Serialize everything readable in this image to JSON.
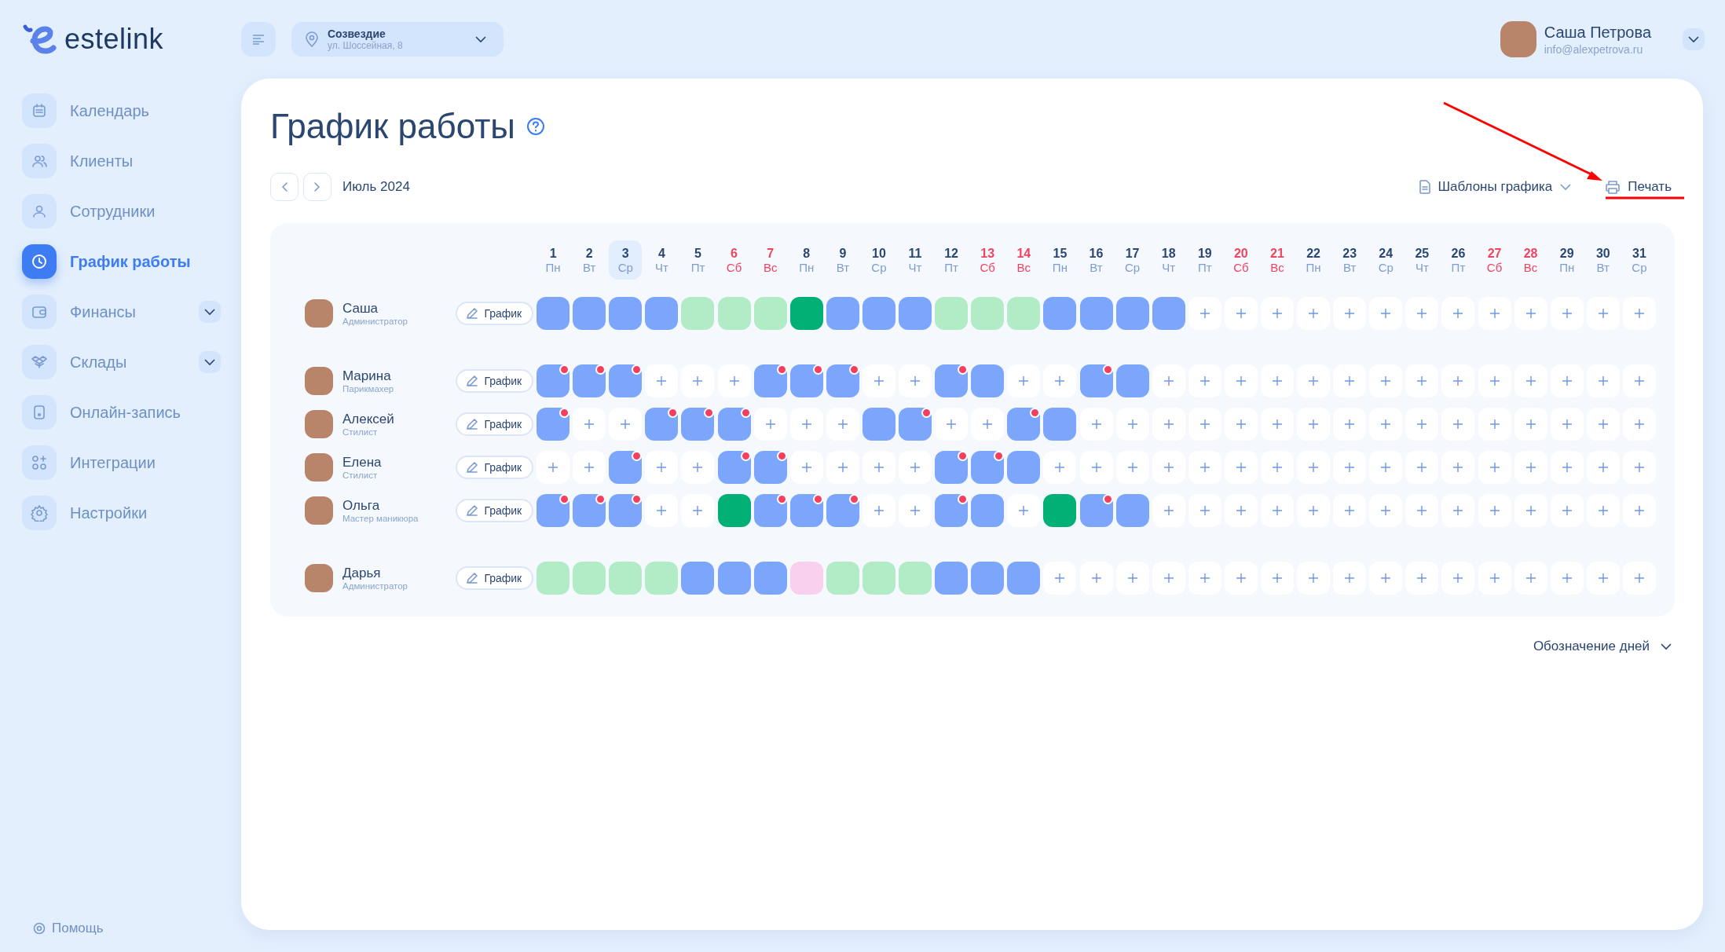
{
  "logo": {
    "text": "estelink"
  },
  "location": {
    "name": "Созвездие",
    "address": "ул. Шоссейная, 8"
  },
  "user": {
    "name": "Саша Петрова",
    "email": "info@alexpetrova.ru"
  },
  "sidebar": {
    "items": [
      {
        "label": "Календарь",
        "selected": false,
        "expandable": false
      },
      {
        "label": "Клиенты",
        "selected": false,
        "expandable": false
      },
      {
        "label": "Сотрудники",
        "selected": false,
        "expandable": false
      },
      {
        "label": "График работы",
        "selected": true,
        "expandable": false
      },
      {
        "label": "Финансы",
        "selected": false,
        "expandable": true
      },
      {
        "label": "Склады",
        "selected": false,
        "expandable": true
      },
      {
        "label": "Онлайн-запись",
        "selected": false,
        "expandable": false
      },
      {
        "label": "Интеграции",
        "selected": false,
        "expandable": false
      },
      {
        "label": "Настройки",
        "selected": false,
        "expandable": false
      }
    ],
    "help": "Помощь"
  },
  "page": {
    "title": "График работы",
    "month": "Июль 2024",
    "templates": "Шаблоны графика",
    "print": {
      "label": "Печать",
      "highlighted": true
    },
    "legend": "Обозначение дней"
  },
  "day_columns": [
    {
      "day": "1",
      "weekday": "Пн",
      "weekend": false,
      "selected": false
    },
    {
      "day": "2",
      "weekday": "Вт",
      "weekend": false,
      "selected": false
    },
    {
      "day": "3",
      "weekday": "Ср",
      "weekend": false,
      "selected": true
    },
    {
      "day": "4",
      "weekday": "Чт",
      "weekend": false,
      "selected": false
    },
    {
      "day": "5",
      "weekday": "Пт",
      "weekend": false,
      "selected": false
    },
    {
      "day": "6",
      "weekday": "Сб",
      "weekend": true,
      "selected": false
    },
    {
      "day": "7",
      "weekday": "Вс",
      "weekend": true,
      "selected": false
    },
    {
      "day": "8",
      "weekday": "Пн",
      "weekend": false,
      "selected": false
    },
    {
      "day": "9",
      "weekday": "Вт",
      "weekend": false,
      "selected": false
    },
    {
      "day": "10",
      "weekday": "Ср",
      "weekend": false,
      "selected": false
    },
    {
      "day": "11",
      "weekday": "Чт",
      "weekend": false,
      "selected": false
    },
    {
      "day": "12",
      "weekday": "Пт",
      "weekend": false,
      "selected": false
    },
    {
      "day": "13",
      "weekday": "Сб",
      "weekend": true,
      "selected": false
    },
    {
      "day": "14",
      "weekday": "Вс",
      "weekend": true,
      "selected": false
    },
    {
      "day": "15",
      "weekday": "Пн",
      "weekend": false,
      "selected": false
    },
    {
      "day": "16",
      "weekday": "Вт",
      "weekend": false,
      "selected": false
    },
    {
      "day": "17",
      "weekday": "Ср",
      "weekend": false,
      "selected": false
    },
    {
      "day": "18",
      "weekday": "Чт",
      "weekend": false,
      "selected": false
    },
    {
      "day": "19",
      "weekday": "Пт",
      "weekend": false,
      "selected": false
    },
    {
      "day": "20",
      "weekday": "Сб",
      "weekend": true,
      "selected": false
    },
    {
      "day": "21",
      "weekday": "Вс",
      "weekend": true,
      "selected": false
    },
    {
      "day": "22",
      "weekday": "Пн",
      "weekend": false,
      "selected": false
    },
    {
      "day": "23",
      "weekday": "Вт",
      "weekend": false,
      "selected": false
    },
    {
      "day": "24",
      "weekday": "Ср",
      "weekend": false,
      "selected": false
    },
    {
      "day": "25",
      "weekday": "Чт",
      "weekend": false,
      "selected": false
    },
    {
      "day": "26",
      "weekday": "Пт",
      "weekend": false,
      "selected": false
    },
    {
      "day": "27",
      "weekday": "Сб",
      "weekend": true,
      "selected": false
    },
    {
      "day": "28",
      "weekday": "Вс",
      "weekend": true,
      "selected": false
    },
    {
      "day": "29",
      "weekday": "Пн",
      "weekend": false,
      "selected": false
    },
    {
      "day": "30",
      "weekday": "Вт",
      "weekend": false,
      "selected": false
    },
    {
      "day": "31",
      "weekday": "Ср",
      "weekend": false,
      "selected": false
    }
  ],
  "groups": [
    {
      "employees": [
        {
          "name": "Саша",
          "role": "Администратор",
          "button": "График",
          "cells": [
            {
              "kind": "work",
              "alert": false
            },
            {
              "kind": "work",
              "alert": false
            },
            {
              "kind": "work",
              "alert": false
            },
            {
              "kind": "work",
              "alert": false
            },
            {
              "kind": "off"
            },
            {
              "kind": "off"
            },
            {
              "kind": "off"
            },
            {
              "kind": "special"
            },
            {
              "kind": "work",
              "alert": false
            },
            {
              "kind": "work",
              "alert": false
            },
            {
              "kind": "work",
              "alert": false
            },
            {
              "kind": "off"
            },
            {
              "kind": "off"
            },
            {
              "kind": "off"
            },
            {
              "kind": "work",
              "alert": false
            },
            {
              "kind": "work",
              "alert": false
            },
            {
              "kind": "work",
              "alert": false
            },
            {
              "kind": "work",
              "alert": false
            },
            {
              "kind": "empty"
            },
            {
              "kind": "empty"
            },
            {
              "kind": "empty"
            },
            {
              "kind": "empty"
            },
            {
              "kind": "empty"
            },
            {
              "kind": "empty"
            },
            {
              "kind": "empty"
            },
            {
              "kind": "empty"
            },
            {
              "kind": "empty"
            },
            {
              "kind": "empty"
            },
            {
              "kind": "empty"
            },
            {
              "kind": "empty"
            },
            {
              "kind": "empty"
            }
          ]
        }
      ]
    },
    {
      "employees": [
        {
          "name": "Марина",
          "role": "Парикмахер",
          "button": "График",
          "cells": [
            {
              "kind": "work",
              "alert": true
            },
            {
              "kind": "work",
              "alert": true
            },
            {
              "kind": "work",
              "alert": true
            },
            {
              "kind": "empty"
            },
            {
              "kind": "empty"
            },
            {
              "kind": "empty"
            },
            {
              "kind": "work",
              "alert": true
            },
            {
              "kind": "work",
              "alert": true
            },
            {
              "kind": "work",
              "alert": true
            },
            {
              "kind": "empty"
            },
            {
              "kind": "empty"
            },
            {
              "kind": "work",
              "alert": true
            },
            {
              "kind": "work",
              "alert": false
            },
            {
              "kind": "empty"
            },
            {
              "kind": "empty"
            },
            {
              "kind": "work",
              "alert": true
            },
            {
              "kind": "work",
              "alert": false
            },
            {
              "kind": "empty"
            },
            {
              "kind": "empty"
            },
            {
              "kind": "empty"
            },
            {
              "kind": "empty"
            },
            {
              "kind": "empty"
            },
            {
              "kind": "empty"
            },
            {
              "kind": "empty"
            },
            {
              "kind": "empty"
            },
            {
              "kind": "empty"
            },
            {
              "kind": "empty"
            },
            {
              "kind": "empty"
            },
            {
              "kind": "empty"
            },
            {
              "kind": "empty"
            },
            {
              "kind": "empty"
            }
          ]
        },
        {
          "name": "Алексей",
          "role": "Стилист",
          "button": "График",
          "cells": [
            {
              "kind": "work",
              "alert": true
            },
            {
              "kind": "empty"
            },
            {
              "kind": "empty"
            },
            {
              "kind": "work",
              "alert": true
            },
            {
              "kind": "work",
              "alert": true
            },
            {
              "kind": "work",
              "alert": true
            },
            {
              "kind": "empty"
            },
            {
              "kind": "empty"
            },
            {
              "kind": "empty"
            },
            {
              "kind": "work",
              "alert": false
            },
            {
              "kind": "work",
              "alert": true
            },
            {
              "kind": "empty"
            },
            {
              "kind": "empty"
            },
            {
              "kind": "work",
              "alert": true
            },
            {
              "kind": "work",
              "alert": false
            },
            {
              "kind": "empty"
            },
            {
              "kind": "empty"
            },
            {
              "kind": "empty"
            },
            {
              "kind": "empty"
            },
            {
              "kind": "empty"
            },
            {
              "kind": "empty"
            },
            {
              "kind": "empty"
            },
            {
              "kind": "empty"
            },
            {
              "kind": "empty"
            },
            {
              "kind": "empty"
            },
            {
              "kind": "empty"
            },
            {
              "kind": "empty"
            },
            {
              "kind": "empty"
            },
            {
              "kind": "empty"
            },
            {
              "kind": "empty"
            },
            {
              "kind": "empty"
            }
          ]
        },
        {
          "name": "Елена",
          "role": "Стилист",
          "button": "График",
          "cells": [
            {
              "kind": "empty"
            },
            {
              "kind": "empty"
            },
            {
              "kind": "work",
              "alert": true
            },
            {
              "kind": "empty"
            },
            {
              "kind": "empty"
            },
            {
              "kind": "work",
              "alert": true
            },
            {
              "kind": "work",
              "alert": true
            },
            {
              "kind": "empty"
            },
            {
              "kind": "empty"
            },
            {
              "kind": "empty"
            },
            {
              "kind": "empty"
            },
            {
              "kind": "work",
              "alert": true
            },
            {
              "kind": "work",
              "alert": true
            },
            {
              "kind": "work",
              "alert": false
            },
            {
              "kind": "empty"
            },
            {
              "kind": "empty"
            },
            {
              "kind": "empty"
            },
            {
              "kind": "empty"
            },
            {
              "kind": "empty"
            },
            {
              "kind": "empty"
            },
            {
              "kind": "empty"
            },
            {
              "kind": "empty"
            },
            {
              "kind": "empty"
            },
            {
              "kind": "empty"
            },
            {
              "kind": "empty"
            },
            {
              "kind": "empty"
            },
            {
              "kind": "empty"
            },
            {
              "kind": "empty"
            },
            {
              "kind": "empty"
            },
            {
              "kind": "empty"
            },
            {
              "kind": "empty"
            }
          ]
        },
        {
          "name": "Ольга",
          "role": "Мастер маникюра",
          "button": "График",
          "cells": [
            {
              "kind": "work",
              "alert": true
            },
            {
              "kind": "work",
              "alert": true
            },
            {
              "kind": "work",
              "alert": true
            },
            {
              "kind": "empty"
            },
            {
              "kind": "empty"
            },
            {
              "kind": "special"
            },
            {
              "kind": "work",
              "alert": true
            },
            {
              "kind": "work",
              "alert": true
            },
            {
              "kind": "work",
              "alert": true
            },
            {
              "kind": "empty"
            },
            {
              "kind": "empty"
            },
            {
              "kind": "work",
              "alert": true
            },
            {
              "kind": "work",
              "alert": false
            },
            {
              "kind": "empty"
            },
            {
              "kind": "special"
            },
            {
              "kind": "work",
              "alert": true
            },
            {
              "kind": "work",
              "alert": false
            },
            {
              "kind": "empty"
            },
            {
              "kind": "empty"
            },
            {
              "kind": "empty"
            },
            {
              "kind": "empty"
            },
            {
              "kind": "empty"
            },
            {
              "kind": "empty"
            },
            {
              "kind": "empty"
            },
            {
              "kind": "empty"
            },
            {
              "kind": "empty"
            },
            {
              "kind": "empty"
            },
            {
              "kind": "empty"
            },
            {
              "kind": "empty"
            },
            {
              "kind": "empty"
            },
            {
              "kind": "empty"
            }
          ]
        }
      ]
    },
    {
      "employees": [
        {
          "name": "Дарья",
          "role": "Администратор",
          "button": "График",
          "cells": [
            {
              "kind": "off"
            },
            {
              "kind": "off"
            },
            {
              "kind": "off"
            },
            {
              "kind": "off"
            },
            {
              "kind": "work",
              "alert": false
            },
            {
              "kind": "work",
              "alert": false
            },
            {
              "kind": "work",
              "alert": false
            },
            {
              "kind": "leave"
            },
            {
              "kind": "off"
            },
            {
              "kind": "off"
            },
            {
              "kind": "off"
            },
            {
              "kind": "work",
              "alert": false
            },
            {
              "kind": "work",
              "alert": false
            },
            {
              "kind": "work",
              "alert": false
            },
            {
              "kind": "empty"
            },
            {
              "kind": "empty"
            },
            {
              "kind": "empty"
            },
            {
              "kind": "empty"
            },
            {
              "kind": "empty"
            },
            {
              "kind": "empty"
            },
            {
              "kind": "empty"
            },
            {
              "kind": "empty"
            },
            {
              "kind": "empty"
            },
            {
              "kind": "empty"
            },
            {
              "kind": "empty"
            },
            {
              "kind": "empty"
            },
            {
              "kind": "empty"
            },
            {
              "kind": "empty"
            },
            {
              "kind": "empty"
            },
            {
              "kind": "empty"
            },
            {
              "kind": "empty"
            }
          ]
        }
      ]
    }
  ]
}
